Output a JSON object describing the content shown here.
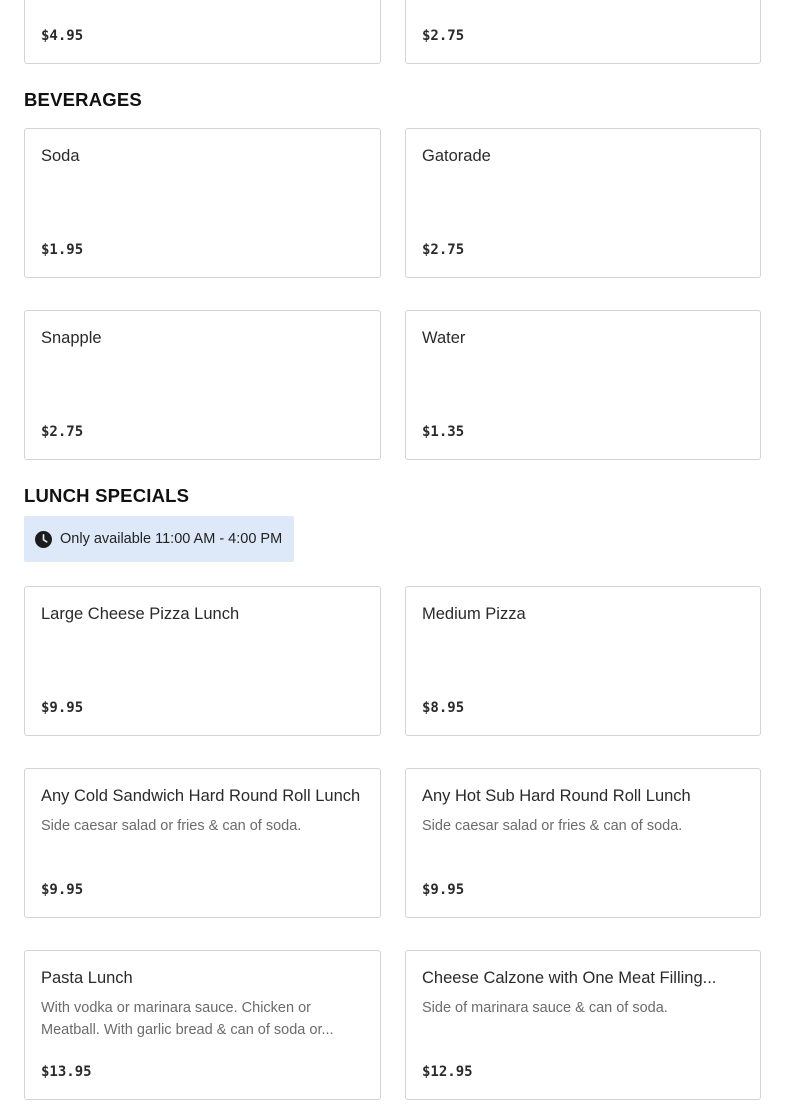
{
  "top_row": [
    {
      "price": "$4.95"
    },
    {
      "price": "$2.75"
    }
  ],
  "beverages": {
    "title": "BEVERAGES",
    "items": [
      {
        "name": "Soda",
        "price": "$1.95"
      },
      {
        "name": "Gatorade",
        "price": "$2.75"
      },
      {
        "name": "Snapple",
        "price": "$2.75"
      },
      {
        "name": "Water",
        "price": "$1.35"
      }
    ]
  },
  "lunch": {
    "title": "LUNCH SPECIALS",
    "availability": "Only available 11:00 AM - 4:00 PM",
    "availability_icon": "clock-icon",
    "items": [
      {
        "name": "Large Cheese Pizza Lunch",
        "desc": "",
        "price": "$9.95"
      },
      {
        "name": "Medium Pizza",
        "desc": "",
        "price": "$8.95"
      },
      {
        "name": "Any Cold Sandwich Hard Round Roll Lunch",
        "desc": "Side caesar salad or fries & can of soda.",
        "price": "$9.95"
      },
      {
        "name": "Any Hot Sub Hard Round Roll Lunch",
        "desc": "Side caesar salad or fries & can of soda.",
        "price": "$9.95"
      },
      {
        "name": "Pasta Lunch",
        "desc": "With vodka or marinara sauce. Chicken or Meatball. With garlic bread & can of soda or...",
        "price": "$13.95"
      },
      {
        "name": "Cheese Calzone with One Meat Filling...",
        "desc": "Side of marinara sauce & can of soda.",
        "price": "$12.95"
      }
    ]
  }
}
